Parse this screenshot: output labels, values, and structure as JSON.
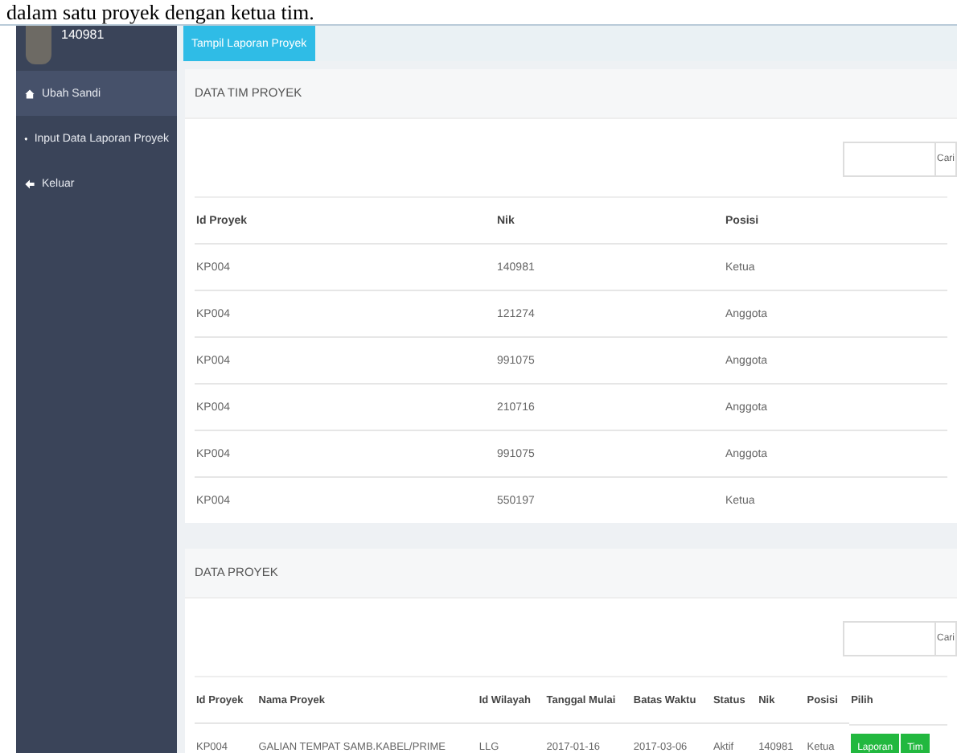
{
  "caption": "dalam satu proyek dengan ketua tim.",
  "sidebar": {
    "username": "140981",
    "items": [
      {
        "label": "Ubah Sandi",
        "selected": true
      },
      {
        "label": "Input Data Laporan Proyek",
        "selected": false
      },
      {
        "label": "Keluar",
        "selected": false
      }
    ]
  },
  "header_button": "Tampil Laporan Proyek",
  "team_panel": {
    "title": "DATA TIM PROYEK",
    "search_button": "Cari",
    "columns": [
      "Id Proyek",
      "Nik",
      "Posisi"
    ],
    "rows": [
      [
        "KP004",
        "140981",
        "Ketua"
      ],
      [
        "KP004",
        "121274",
        "Anggota"
      ],
      [
        "KP004",
        "991075",
        "Anggota"
      ],
      [
        "KP004",
        "210716",
        "Anggota"
      ],
      [
        "KP004",
        "991075",
        "Anggota"
      ],
      [
        "KP004",
        "550197",
        "Ketua"
      ]
    ]
  },
  "project_panel": {
    "title": "DATA PROYEK",
    "search_button": "Cari",
    "columns": [
      "Id Proyek",
      "Nama Proyek",
      "Id Wilayah",
      "Tanggal Mulai",
      "Batas Waktu",
      "Status",
      "Nik",
      "Posisi",
      "Pilih"
    ],
    "rows": [
      {
        "cells": [
          "KP004",
          "GALIAN TEMPAT SAMB.KABEL/PRIME",
          "LLG",
          "2017-01-16",
          "2017-03-06",
          "Aktif",
          "140981",
          "Ketua"
        ],
        "actions": [
          "Laporan",
          "Tim"
        ]
      }
    ]
  }
}
